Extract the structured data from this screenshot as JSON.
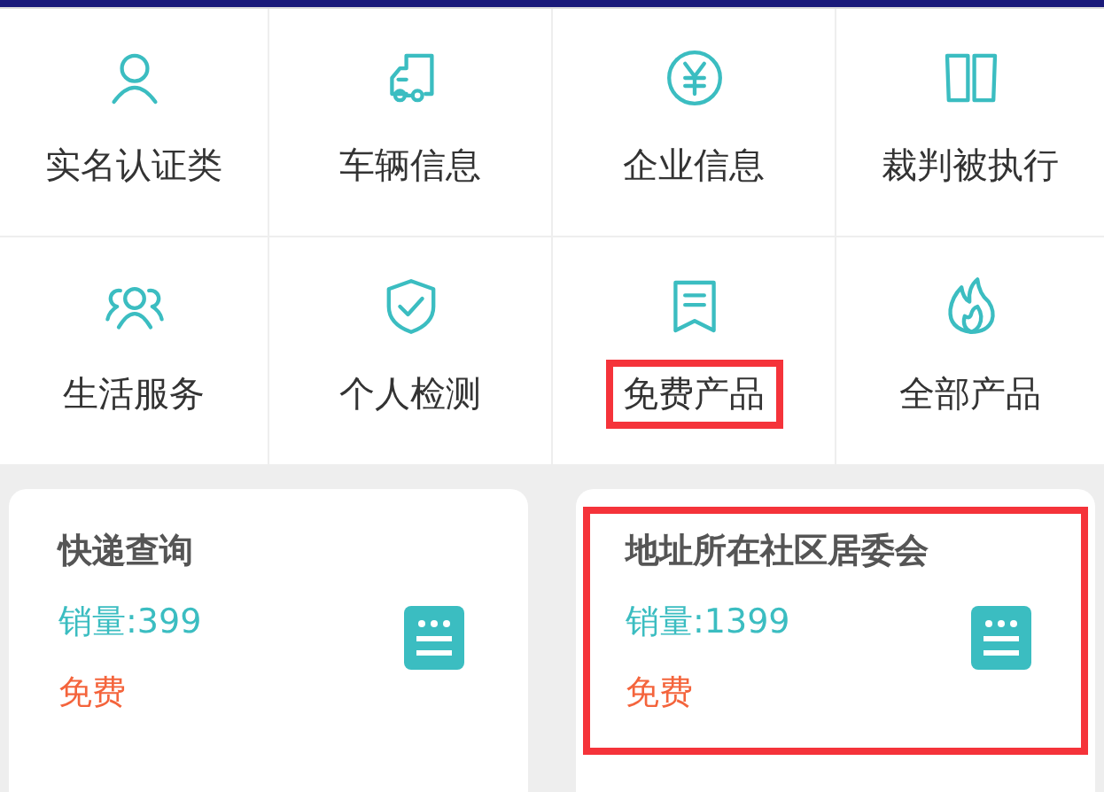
{
  "categories": [
    {
      "label": "实名认证类",
      "highlighted": false
    },
    {
      "label": "车辆信息",
      "highlighted": false
    },
    {
      "label": "企业信息",
      "highlighted": false
    },
    {
      "label": "裁判被执行",
      "highlighted": false
    },
    {
      "label": "生活服务",
      "highlighted": false
    },
    {
      "label": "个人检测",
      "highlighted": false
    },
    {
      "label": "免费产品",
      "highlighted": true
    },
    {
      "label": "全部产品",
      "highlighted": false
    }
  ],
  "products": [
    {
      "title": "快递查询",
      "sales": "销量:399",
      "price": "免费",
      "highlighted": false
    },
    {
      "title": "地址所在社区居委会",
      "sales": "销量:1399",
      "price": "免费",
      "highlighted": true
    }
  ]
}
